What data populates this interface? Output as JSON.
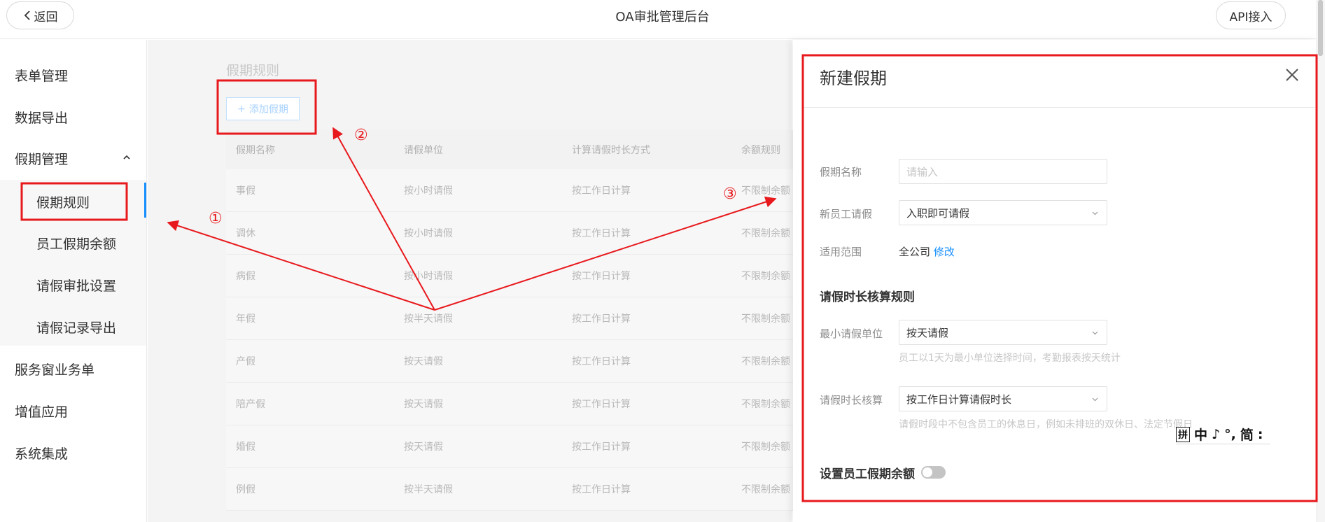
{
  "header": {
    "back_label": "返回",
    "title": "OA审批管理后台",
    "api_label": "API接入"
  },
  "sidebar": {
    "items": [
      {
        "label": "表单管理"
      },
      {
        "label": "数据导出"
      },
      {
        "label": "假期管理"
      },
      {
        "label": "服务窗业务单"
      },
      {
        "label": "增值应用"
      },
      {
        "label": "系统集成"
      }
    ],
    "sub_items": [
      {
        "label": "假期规则"
      },
      {
        "label": "员工假期余额"
      },
      {
        "label": "请假审批设置"
      },
      {
        "label": "请假记录导出"
      }
    ]
  },
  "main": {
    "title": "假期规则",
    "add_button": "添加假期",
    "table": {
      "headers": [
        "假期名称",
        "请假单位",
        "计算请假时长方式",
        "余额规则"
      ],
      "rows": [
        [
          "事假",
          "按小时请假",
          "按工作日计算",
          "不限制余额"
        ],
        [
          "调休",
          "按小时请假",
          "按工作日计算",
          "不限制余额"
        ],
        [
          "病假",
          "按小时请假",
          "按工作日计算",
          "不限制余额"
        ],
        [
          "年假",
          "按半天请假",
          "按工作日计算",
          "不限制余额"
        ],
        [
          "产假",
          "按天请假",
          "按工作日计算",
          "不限制余额"
        ],
        [
          "陪产假",
          "按天请假",
          "按工作日计算",
          "不限制余额"
        ],
        [
          "婚假",
          "按天请假",
          "按工作日计算",
          "不限制余额"
        ],
        [
          "例假",
          "按半天请假",
          "按工作日计算",
          "不限制余额"
        ]
      ]
    }
  },
  "drawer": {
    "title": "新建假期",
    "fields": {
      "name_label": "假期名称",
      "name_placeholder": "请输入",
      "new_employee_label": "新员工请假",
      "new_employee_value": "入职即可请假",
      "scope_label": "适用范围",
      "scope_value": "全公司",
      "scope_edit": "修改"
    },
    "section_rules": "请假时长核算规则",
    "min_unit_label": "最小请假单位",
    "min_unit_value": "按天请假",
    "min_unit_hint": "员工以1天为最小单位选择时间，考勤报表按天统计",
    "calc_label": "请假时长核算",
    "calc_value": "按工作日计算请假时长",
    "calc_hint": "请假时段中不包含员工的休息日，例如未排班的双休日、法定节假日",
    "balance_label": "设置员工假期余额",
    "balance_enabled": false
  },
  "ime": {
    "box": "拼",
    "items": [
      "中",
      "♪",
      "°,",
      "简",
      ":"
    ]
  },
  "annotations": {
    "markers": [
      "①",
      "②",
      "③"
    ],
    "color": "#e8191d"
  }
}
